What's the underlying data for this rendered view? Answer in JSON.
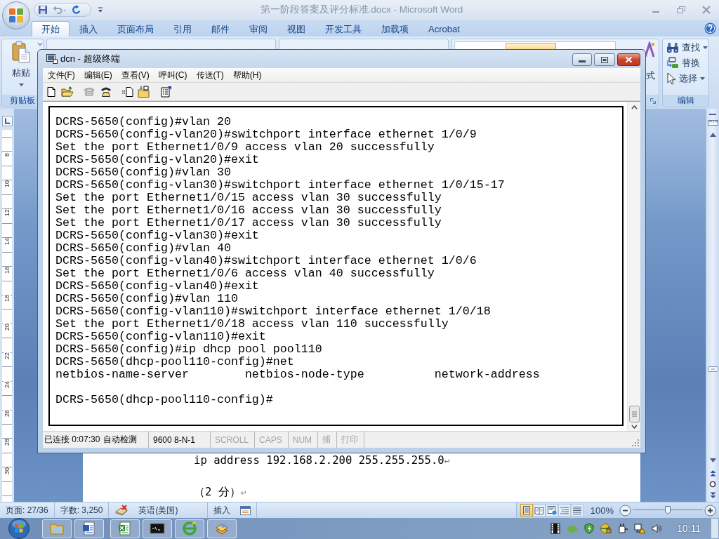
{
  "word": {
    "title": "第一阶段答案及评分标准.docx - Microsoft Word",
    "tabs": [
      {
        "label": "开始",
        "selected": true
      },
      {
        "label": "插入",
        "selected": false
      },
      {
        "label": "页面布局",
        "selected": false
      },
      {
        "label": "引用",
        "selected": false
      },
      {
        "label": "邮件",
        "selected": false
      },
      {
        "label": "审阅",
        "selected": false
      },
      {
        "label": "视图",
        "selected": false
      },
      {
        "label": "开发工具",
        "selected": false
      },
      {
        "label": "加载项",
        "selected": false
      },
      {
        "label": "Acrobat",
        "selected": false
      }
    ],
    "clipboard": {
      "paste": "粘贴",
      "label": "剪贴板"
    },
    "styles": {
      "label_fragment": "式"
    },
    "editing": {
      "items": [
        {
          "kind": "find",
          "label": "查找",
          "dropdown": true
        },
        {
          "kind": "replace",
          "label": "替换",
          "dropdown": false
        },
        {
          "kind": "select",
          "label": "选择",
          "dropdown": true
        }
      ],
      "label": "编辑"
    },
    "ruler": [
      "8",
      "10",
      "12",
      "14",
      "16",
      "18",
      "20",
      "22",
      "24",
      "26",
      "28",
      "30"
    ],
    "paragraphs": [
      {
        "text": "ip address 192.168.2.200 255.255.255.0",
        "mark": "↵"
      },
      {
        "text": "（2 分）",
        "mark": "↵"
      }
    ],
    "status_bar": {
      "page": "页面: 27/36",
      "words": "字数: 3,250",
      "language": "英语(美国)",
      "mode": "插入",
      "views": [
        {
          "kind": "print",
          "selected": true
        },
        {
          "kind": "reading",
          "selected": false
        },
        {
          "kind": "web",
          "selected": false
        },
        {
          "kind": "outline",
          "selected": false
        },
        {
          "kind": "draft",
          "selected": false
        }
      ],
      "zoom": "100%",
      "zoom_slider": {
        "level": 0.5
      }
    }
  },
  "terminal": {
    "title": "dcn - 超级终端",
    "menu": [
      "文件(F)",
      "编辑(E)",
      "查看(V)",
      "呼叫(C)",
      "传送(T)",
      "帮助(H)"
    ],
    "toolbar": [
      {
        "kind": "new",
        "disabled": false
      },
      {
        "kind": "open",
        "disabled": false
      },
      {
        "kind": "call",
        "disabled": true
      },
      {
        "kind": "hang-up",
        "disabled": false
      },
      {
        "kind": "send",
        "disabled": false
      },
      {
        "kind": "receive",
        "disabled": false
      },
      {
        "kind": "properties",
        "disabled": false
      }
    ],
    "lines": [
      "DCRS-5650(config)#vlan 20",
      "DCRS-5650(config-vlan20)#switchport interface ethernet 1/0/9",
      "Set the port Ethernet1/0/9 access vlan 20 successfully",
      "DCRS-5650(config-vlan20)#exit",
      "DCRS-5650(config)#vlan 30",
      "DCRS-5650(config-vlan30)#switchport interface ethernet 1/0/15-17",
      "Set the port Ethernet1/0/15 access vlan 30 successfully",
      "Set the port Ethernet1/0/16 access vlan 30 successfully",
      "Set the port Ethernet1/0/17 access vlan 30 successfully",
      "DCRS-5650(config-vlan30)#exit",
      "DCRS-5650(config)#vlan 40",
      "DCRS-5650(config-vlan40)#switchport interface ethernet 1/0/6",
      "Set the port Ethernet1/0/6 access vlan 40 successfully",
      "DCRS-5650(config-vlan40)#exit",
      "DCRS-5650(config)#vlan 110",
      "DCRS-5650(config-vlan110)#switchport interface ethernet 1/0/18",
      "Set the port Ethernet1/0/18 access vlan 110 successfully",
      "DCRS-5650(config-vlan110)#exit",
      "DCRS-5650(config)#ip dhcp pool pool110",
      "DCRS-5650(dhcp-pool110-config)#net",
      "netbios-name-server        netbios-node-type          network-address"
    ],
    "prompt": "DCRS-5650(dhcp-pool110-config)#",
    "status_bar": {
      "connection": "已连接 0:07:30",
      "detection": "自动检测",
      "settings": "9600 8-N-1",
      "indicators": [
        {
          "label": "SCROLL",
          "on": false
        },
        {
          "label": "CAPS",
          "on": false
        },
        {
          "label": "NUM",
          "on": false
        },
        {
          "label": "捕",
          "on": false
        },
        {
          "label": "打印",
          "on": false
        }
      ]
    }
  },
  "taskbar": {
    "time": "10:11"
  }
}
